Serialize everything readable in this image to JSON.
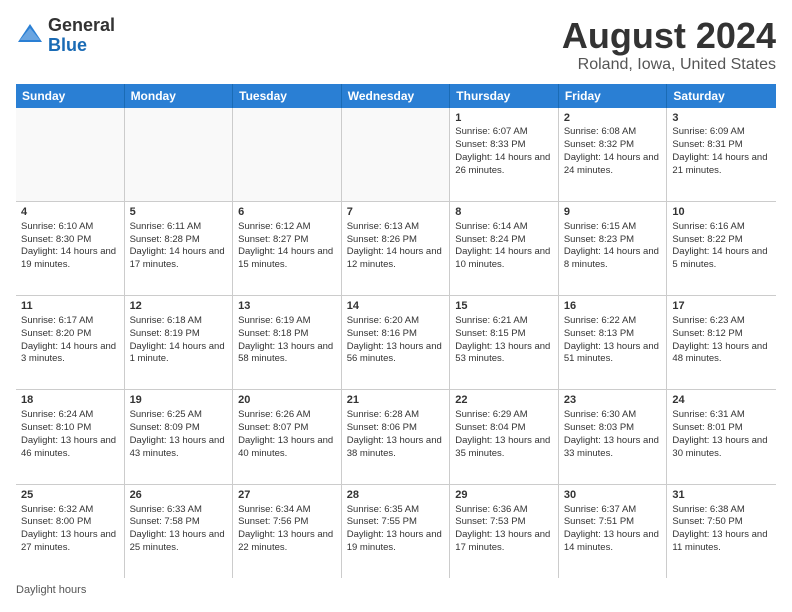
{
  "logo": {
    "general": "General",
    "blue": "Blue"
  },
  "title": "August 2024",
  "subtitle": "Roland, Iowa, United States",
  "days": [
    "Sunday",
    "Monday",
    "Tuesday",
    "Wednesday",
    "Thursday",
    "Friday",
    "Saturday"
  ],
  "footer": "Daylight hours",
  "weeks": [
    [
      {
        "num": "",
        "sunrise": "",
        "sunset": "",
        "daylight": "",
        "empty": true
      },
      {
        "num": "",
        "sunrise": "",
        "sunset": "",
        "daylight": "",
        "empty": true
      },
      {
        "num": "",
        "sunrise": "",
        "sunset": "",
        "daylight": "",
        "empty": true
      },
      {
        "num": "",
        "sunrise": "",
        "sunset": "",
        "daylight": "",
        "empty": true
      },
      {
        "num": "1",
        "sunrise": "Sunrise: 6:07 AM",
        "sunset": "Sunset: 8:33 PM",
        "daylight": "Daylight: 14 hours and 26 minutes.",
        "empty": false
      },
      {
        "num": "2",
        "sunrise": "Sunrise: 6:08 AM",
        "sunset": "Sunset: 8:32 PM",
        "daylight": "Daylight: 14 hours and 24 minutes.",
        "empty": false
      },
      {
        "num": "3",
        "sunrise": "Sunrise: 6:09 AM",
        "sunset": "Sunset: 8:31 PM",
        "daylight": "Daylight: 14 hours and 21 minutes.",
        "empty": false
      }
    ],
    [
      {
        "num": "4",
        "sunrise": "Sunrise: 6:10 AM",
        "sunset": "Sunset: 8:30 PM",
        "daylight": "Daylight: 14 hours and 19 minutes.",
        "empty": false
      },
      {
        "num": "5",
        "sunrise": "Sunrise: 6:11 AM",
        "sunset": "Sunset: 8:28 PM",
        "daylight": "Daylight: 14 hours and 17 minutes.",
        "empty": false
      },
      {
        "num": "6",
        "sunrise": "Sunrise: 6:12 AM",
        "sunset": "Sunset: 8:27 PM",
        "daylight": "Daylight: 14 hours and 15 minutes.",
        "empty": false
      },
      {
        "num": "7",
        "sunrise": "Sunrise: 6:13 AM",
        "sunset": "Sunset: 8:26 PM",
        "daylight": "Daylight: 14 hours and 12 minutes.",
        "empty": false
      },
      {
        "num": "8",
        "sunrise": "Sunrise: 6:14 AM",
        "sunset": "Sunset: 8:24 PM",
        "daylight": "Daylight: 14 hours and 10 minutes.",
        "empty": false
      },
      {
        "num": "9",
        "sunrise": "Sunrise: 6:15 AM",
        "sunset": "Sunset: 8:23 PM",
        "daylight": "Daylight: 14 hours and 8 minutes.",
        "empty": false
      },
      {
        "num": "10",
        "sunrise": "Sunrise: 6:16 AM",
        "sunset": "Sunset: 8:22 PM",
        "daylight": "Daylight: 14 hours and 5 minutes.",
        "empty": false
      }
    ],
    [
      {
        "num": "11",
        "sunrise": "Sunrise: 6:17 AM",
        "sunset": "Sunset: 8:20 PM",
        "daylight": "Daylight: 14 hours and 3 minutes.",
        "empty": false
      },
      {
        "num": "12",
        "sunrise": "Sunrise: 6:18 AM",
        "sunset": "Sunset: 8:19 PM",
        "daylight": "Daylight: 14 hours and 1 minute.",
        "empty": false
      },
      {
        "num": "13",
        "sunrise": "Sunrise: 6:19 AM",
        "sunset": "Sunset: 8:18 PM",
        "daylight": "Daylight: 13 hours and 58 minutes.",
        "empty": false
      },
      {
        "num": "14",
        "sunrise": "Sunrise: 6:20 AM",
        "sunset": "Sunset: 8:16 PM",
        "daylight": "Daylight: 13 hours and 56 minutes.",
        "empty": false
      },
      {
        "num": "15",
        "sunrise": "Sunrise: 6:21 AM",
        "sunset": "Sunset: 8:15 PM",
        "daylight": "Daylight: 13 hours and 53 minutes.",
        "empty": false
      },
      {
        "num": "16",
        "sunrise": "Sunrise: 6:22 AM",
        "sunset": "Sunset: 8:13 PM",
        "daylight": "Daylight: 13 hours and 51 minutes.",
        "empty": false
      },
      {
        "num": "17",
        "sunrise": "Sunrise: 6:23 AM",
        "sunset": "Sunset: 8:12 PM",
        "daylight": "Daylight: 13 hours and 48 minutes.",
        "empty": false
      }
    ],
    [
      {
        "num": "18",
        "sunrise": "Sunrise: 6:24 AM",
        "sunset": "Sunset: 8:10 PM",
        "daylight": "Daylight: 13 hours and 46 minutes.",
        "empty": false
      },
      {
        "num": "19",
        "sunrise": "Sunrise: 6:25 AM",
        "sunset": "Sunset: 8:09 PM",
        "daylight": "Daylight: 13 hours and 43 minutes.",
        "empty": false
      },
      {
        "num": "20",
        "sunrise": "Sunrise: 6:26 AM",
        "sunset": "Sunset: 8:07 PM",
        "daylight": "Daylight: 13 hours and 40 minutes.",
        "empty": false
      },
      {
        "num": "21",
        "sunrise": "Sunrise: 6:28 AM",
        "sunset": "Sunset: 8:06 PM",
        "daylight": "Daylight: 13 hours and 38 minutes.",
        "empty": false
      },
      {
        "num": "22",
        "sunrise": "Sunrise: 6:29 AM",
        "sunset": "Sunset: 8:04 PM",
        "daylight": "Daylight: 13 hours and 35 minutes.",
        "empty": false
      },
      {
        "num": "23",
        "sunrise": "Sunrise: 6:30 AM",
        "sunset": "Sunset: 8:03 PM",
        "daylight": "Daylight: 13 hours and 33 minutes.",
        "empty": false
      },
      {
        "num": "24",
        "sunrise": "Sunrise: 6:31 AM",
        "sunset": "Sunset: 8:01 PM",
        "daylight": "Daylight: 13 hours and 30 minutes.",
        "empty": false
      }
    ],
    [
      {
        "num": "25",
        "sunrise": "Sunrise: 6:32 AM",
        "sunset": "Sunset: 8:00 PM",
        "daylight": "Daylight: 13 hours and 27 minutes.",
        "empty": false
      },
      {
        "num": "26",
        "sunrise": "Sunrise: 6:33 AM",
        "sunset": "Sunset: 7:58 PM",
        "daylight": "Daylight: 13 hours and 25 minutes.",
        "empty": false
      },
      {
        "num": "27",
        "sunrise": "Sunrise: 6:34 AM",
        "sunset": "Sunset: 7:56 PM",
        "daylight": "Daylight: 13 hours and 22 minutes.",
        "empty": false
      },
      {
        "num": "28",
        "sunrise": "Sunrise: 6:35 AM",
        "sunset": "Sunset: 7:55 PM",
        "daylight": "Daylight: 13 hours and 19 minutes.",
        "empty": false
      },
      {
        "num": "29",
        "sunrise": "Sunrise: 6:36 AM",
        "sunset": "Sunset: 7:53 PM",
        "daylight": "Daylight: 13 hours and 17 minutes.",
        "empty": false
      },
      {
        "num": "30",
        "sunrise": "Sunrise: 6:37 AM",
        "sunset": "Sunset: 7:51 PM",
        "daylight": "Daylight: 13 hours and 14 minutes.",
        "empty": false
      },
      {
        "num": "31",
        "sunrise": "Sunrise: 6:38 AM",
        "sunset": "Sunset: 7:50 PM",
        "daylight": "Daylight: 13 hours and 11 minutes.",
        "empty": false
      }
    ]
  ]
}
